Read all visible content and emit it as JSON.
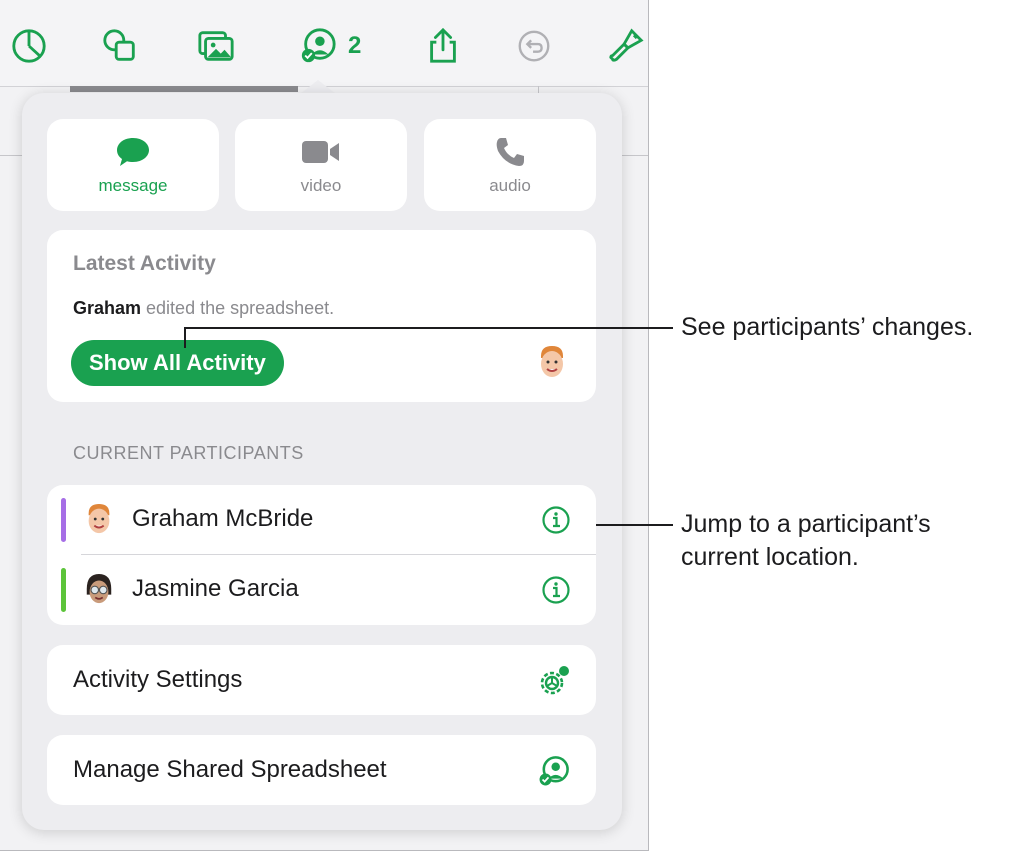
{
  "toolbar": {
    "icons": [
      "chart-icon",
      "shapes-icon",
      "media-icon",
      "collaborate-icon",
      "share-icon",
      "undo-icon",
      "format-brush-icon"
    ],
    "collaborator_count": "2",
    "accent_color": "#1aa150"
  },
  "comm": {
    "message": "message",
    "video": "video",
    "audio": "audio"
  },
  "latest_activity": {
    "title": "Latest Activity",
    "actor": "Graham",
    "action": " edited the spreadsheet.",
    "button": "Show All Activity"
  },
  "participants": {
    "header": "CURRENT PARTICIPANTS",
    "items": [
      {
        "name": "Graham McBride",
        "color": "#a66ee6"
      },
      {
        "name": "Jasmine Garcia",
        "color": "#5cc43a"
      }
    ]
  },
  "activity_settings": "Activity Settings",
  "manage_shared": "Manage Shared Spreadsheet",
  "callouts": {
    "changes": "See participants’ changes.",
    "jump_line1": "Jump to a participant’s",
    "jump_line2": "current location."
  }
}
